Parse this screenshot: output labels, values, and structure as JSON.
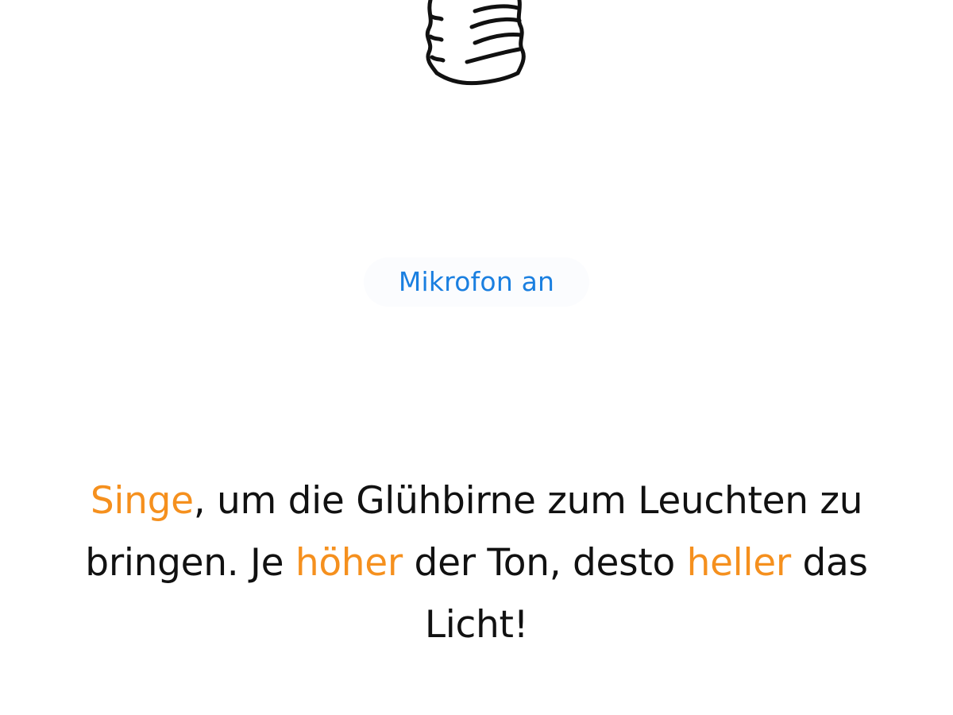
{
  "lightbulb": {
    "icon": "lightbulb-screw-base-icon"
  },
  "mic_toggle": {
    "label": "Mikrofon an"
  },
  "instructions": {
    "w1": "Singe",
    "t1": ", um die Glühbirne zum Leuchten zu bringen. Je ",
    "w2": "höher",
    "t2": " der Ton, desto ",
    "w3": "heller",
    "t3": " das Licht!"
  },
  "colors": {
    "highlight": "#f5901e",
    "accent_text": "#1a7fe0",
    "body_text": "#111111",
    "background": "#ffffff"
  }
}
